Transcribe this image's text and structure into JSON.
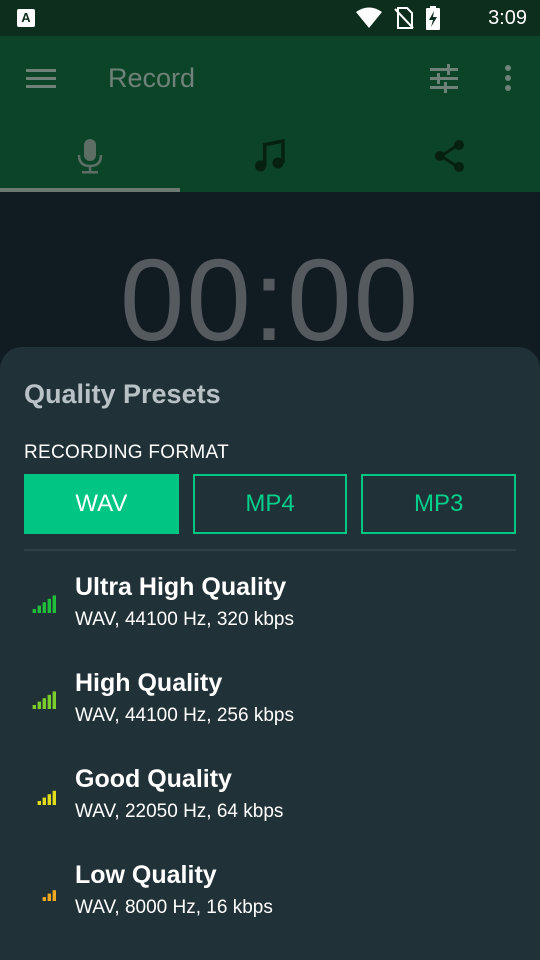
{
  "status_bar": {
    "time": "3:09",
    "left_icon_letter": "A"
  },
  "app_bar": {
    "title": "Record"
  },
  "tabs": [
    {
      "name": "record",
      "icon": "microphone-icon",
      "active": true
    },
    {
      "name": "recordings",
      "icon": "music-note-icon",
      "active": false
    },
    {
      "name": "share",
      "icon": "share-icon",
      "active": false
    }
  ],
  "timer": {
    "value": "00:00"
  },
  "sheet": {
    "title": "Quality Presets",
    "format_label": "RECORDING FORMAT",
    "formats": [
      {
        "label": "WAV",
        "selected": true
      },
      {
        "label": "MP4",
        "selected": false
      },
      {
        "label": "MP3",
        "selected": false
      }
    ],
    "presets": [
      {
        "title": "Ultra High Quality",
        "subtitle": "WAV, 44100 Hz, 320 kbps",
        "bars": 5,
        "color": "#1fbf3a"
      },
      {
        "title": "High Quality",
        "subtitle": "WAV, 44100 Hz, 256 kbps",
        "bars": 5,
        "color": "#7ccf2a"
      },
      {
        "title": "Good Quality",
        "subtitle": "WAV, 22050 Hz, 64 kbps",
        "bars": 4,
        "color": "#e3dc1a"
      },
      {
        "title": "Low Quality",
        "subtitle": "WAV, 8000 Hz, 16 kbps",
        "bars": 3,
        "color": "#f0a81e"
      }
    ]
  },
  "colors": {
    "accent": "#00c583",
    "app_bar": "#0c4427",
    "sheet": "#213138"
  }
}
